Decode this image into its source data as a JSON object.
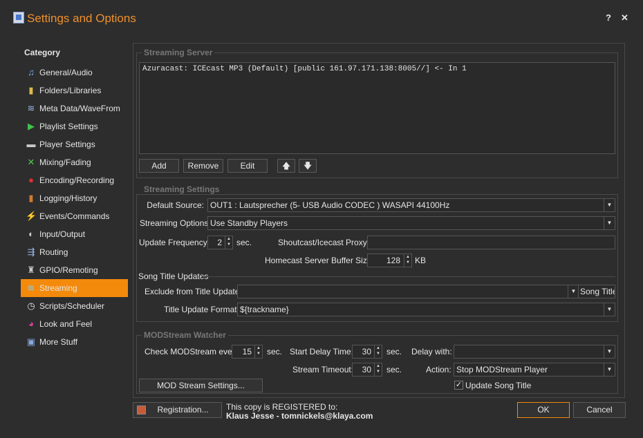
{
  "window": {
    "title": "Settings and Options",
    "help": "?",
    "close": "✕"
  },
  "sidebar": {
    "heading": "Category",
    "items": [
      {
        "label": "General/Audio",
        "icon": "♫",
        "color": "#7fb0ff"
      },
      {
        "label": "Folders/Libraries",
        "icon": "▮",
        "color": "#e0b84a"
      },
      {
        "label": "Meta Data/WaveFrom",
        "icon": "≋",
        "color": "#9ab8e8"
      },
      {
        "label": "Playlist Settings",
        "icon": "▶",
        "color": "#3fc24a"
      },
      {
        "label": "Player Settings",
        "icon": "▬",
        "color": "#c8c8c8"
      },
      {
        "label": "Mixing/Fading",
        "icon": "✕",
        "color": "#4ad04a"
      },
      {
        "label": "Encoding/Recording",
        "icon": "●",
        "color": "#e03030"
      },
      {
        "label": "Logging/History",
        "icon": "▮",
        "color": "#d07a30"
      },
      {
        "label": "Events/Commands",
        "icon": "⚡",
        "color": "#f0c030"
      },
      {
        "label": "Input/Output",
        "icon": "◐",
        "color": "#d0d0d0"
      },
      {
        "label": "Routing",
        "icon": "⇶",
        "color": "#9ab8e8"
      },
      {
        "label": "GPIO/Remoting",
        "icon": "♜",
        "color": "#c8c8c8"
      },
      {
        "label": "Streaming",
        "icon": "≋",
        "color": "#7ad0ff"
      },
      {
        "label": "Scripts/Scheduler",
        "icon": "◷",
        "color": "#e0e0e0"
      },
      {
        "label": "Look and Feel",
        "icon": "◕",
        "color": "#e040a0"
      },
      {
        "label": "More Stuff",
        "icon": "▣",
        "color": "#8aa8e0"
      }
    ],
    "active_index": 12
  },
  "server": {
    "title": "Streaming Server",
    "entries": [
      "Azuracast: ICEcast MP3 (Default) [public 161.97.171.138:8005//] <- In 1"
    ],
    "add": "Add",
    "remove": "Remove",
    "edit": "Edit",
    "up": "🡅",
    "down": "🡇"
  },
  "settings": {
    "title": "Streaming Settings",
    "default_source_label": "Default Source:",
    "default_source": "OUT1 : Lautsprecher (5- USB Audio CODEC ) WASAPI 44100Hz",
    "options_label": "Streaming Options:",
    "options": "Use Standby Players",
    "update_freq_label": "Update Frequency:",
    "update_freq": "2",
    "sec": "sec.",
    "proxy_label": "Shoutcast/Icecast Proxy:",
    "proxy": "",
    "buffer_label": "Homecast Server Buffer Size:",
    "buffer": "128",
    "kb": "KB",
    "title_updates": "Song Title Updates",
    "exclude_label": "Exclude from Title Update:",
    "exclude": "",
    "exclude_option": "Song Title",
    "format_label": "Title Update Format:",
    "format": "${trackname}"
  },
  "watcher": {
    "title": "MODStream Watcher",
    "check_label": "Check MODStream every:",
    "check": "15",
    "sec": "sec.",
    "start_delay_label": "Start Delay Time:",
    "start_delay": "30",
    "delay_with_label": "Delay with:",
    "delay_with": "",
    "timeout_label": "Stream Timeout:",
    "timeout": "30",
    "action_label": "Action:",
    "action": "Stop MODStream Player",
    "settings_button": "MOD Stream Settings...",
    "update_title_label": "Update Song Title",
    "update_title_checked": true
  },
  "footer": {
    "registration": "Registration...",
    "registered_to": "This copy is REGISTERED to:",
    "registered_name": "Klaus Jesse - tomnickels@klaya.com",
    "ok": "OK",
    "cancel": "Cancel"
  },
  "colors": {
    "accent": "#f48a0c",
    "title": "#f0902a"
  }
}
